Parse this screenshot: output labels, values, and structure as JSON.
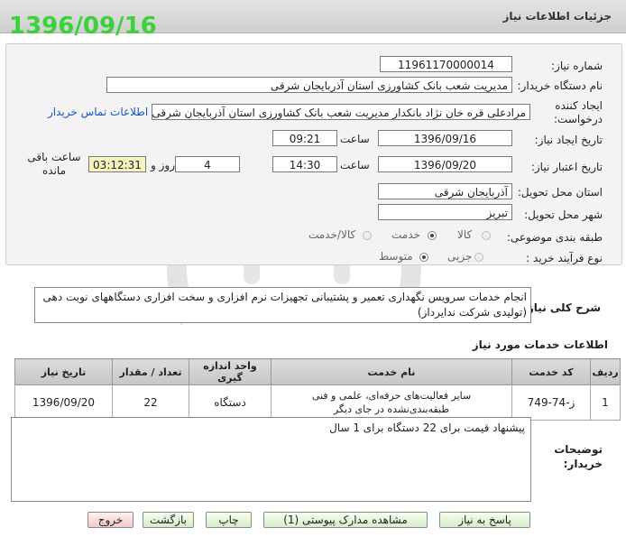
{
  "window": {
    "title": "جزئیات اطلاعات نیاز"
  },
  "stamp_date": "1396/09/16",
  "form": {
    "need_number": {
      "label": "شماره نیاز:",
      "value": "11961170000014"
    },
    "buyer_org": {
      "label": "نام دستگاه خریدار:",
      "value": "مدیریت شعب بانک کشاورزی استان آذربایجان شرقی"
    },
    "requester": {
      "label": "ایجاد کننده درخواست:",
      "value": "مرادعلی قره خان نژاد بانکدار مدیریت شعب بانک کشاورزی استان آذربایجان شرقی",
      "contact_link": "اطلاعات تماس خریدار"
    },
    "created": {
      "label": "تاریخ ایجاد نیاز:",
      "date": "1396/09/16",
      "time_label": "ساعت",
      "time": "09:21"
    },
    "validity": {
      "label": "تاریخ اعتبار نیاز:",
      "date": "1396/09/20",
      "time_label": "ساعت",
      "time": "14:30",
      "days": "4",
      "days_label": "روز و",
      "remaining": "03:12:31",
      "remaining_label": "ساعت باقی مانده"
    },
    "province": {
      "label": "استان محل تحویل:",
      "value": "آذربایجان شرقی"
    },
    "city": {
      "label": "شهر محل تحویل:",
      "value": "تبریز"
    },
    "category": {
      "label": "طبقه بندی موضوعی:",
      "options": [
        "کالا",
        "خدمت",
        "کالا/خدمت"
      ],
      "selected": "خدمت"
    },
    "process": {
      "label": "نوع فرآیند خرید :",
      "options": [
        "جزیی",
        "متوسط"
      ],
      "selected": "متوسط"
    }
  },
  "summary": {
    "label": "شرح کلی نیاز:",
    "text": "انجام خدمات سرویس نگهداری تعمیر و پشتیبانی تجهیزات نرم افزاری و سخت افزاری دستگاههای نوبت دهی (تولیدی شرکت ندایرداز)"
  },
  "services": {
    "heading": "اطلاعات خدمات مورد نیاز",
    "columns": [
      "ردیف",
      "کد خدمت",
      "نام خدمت",
      "واحد اندازه گیری",
      "تعداد / مقدار",
      "تاریخ نیاز"
    ],
    "rows": [
      {
        "row": "1",
        "code": "ز-74-749",
        "name": "سایر فعالیت‌های حرفه‌ای، علمی و فنی طبقه‌بندی‌نشده در جای دیگر",
        "unit": "دستگاه",
        "qty": "22",
        "date": "1396/09/20"
      }
    ]
  },
  "notes": {
    "label": "توضیحات خریدار:",
    "text": "پیشنهاد قیمت برای 22 دستگاه برای 1 سال"
  },
  "buttons": {
    "reply": "پاسخ به نیاز",
    "attachments": "مشاهده مدارک پیوستی (1)",
    "print": "چاپ",
    "back": "بازگشت",
    "exit": "خروج"
  }
}
